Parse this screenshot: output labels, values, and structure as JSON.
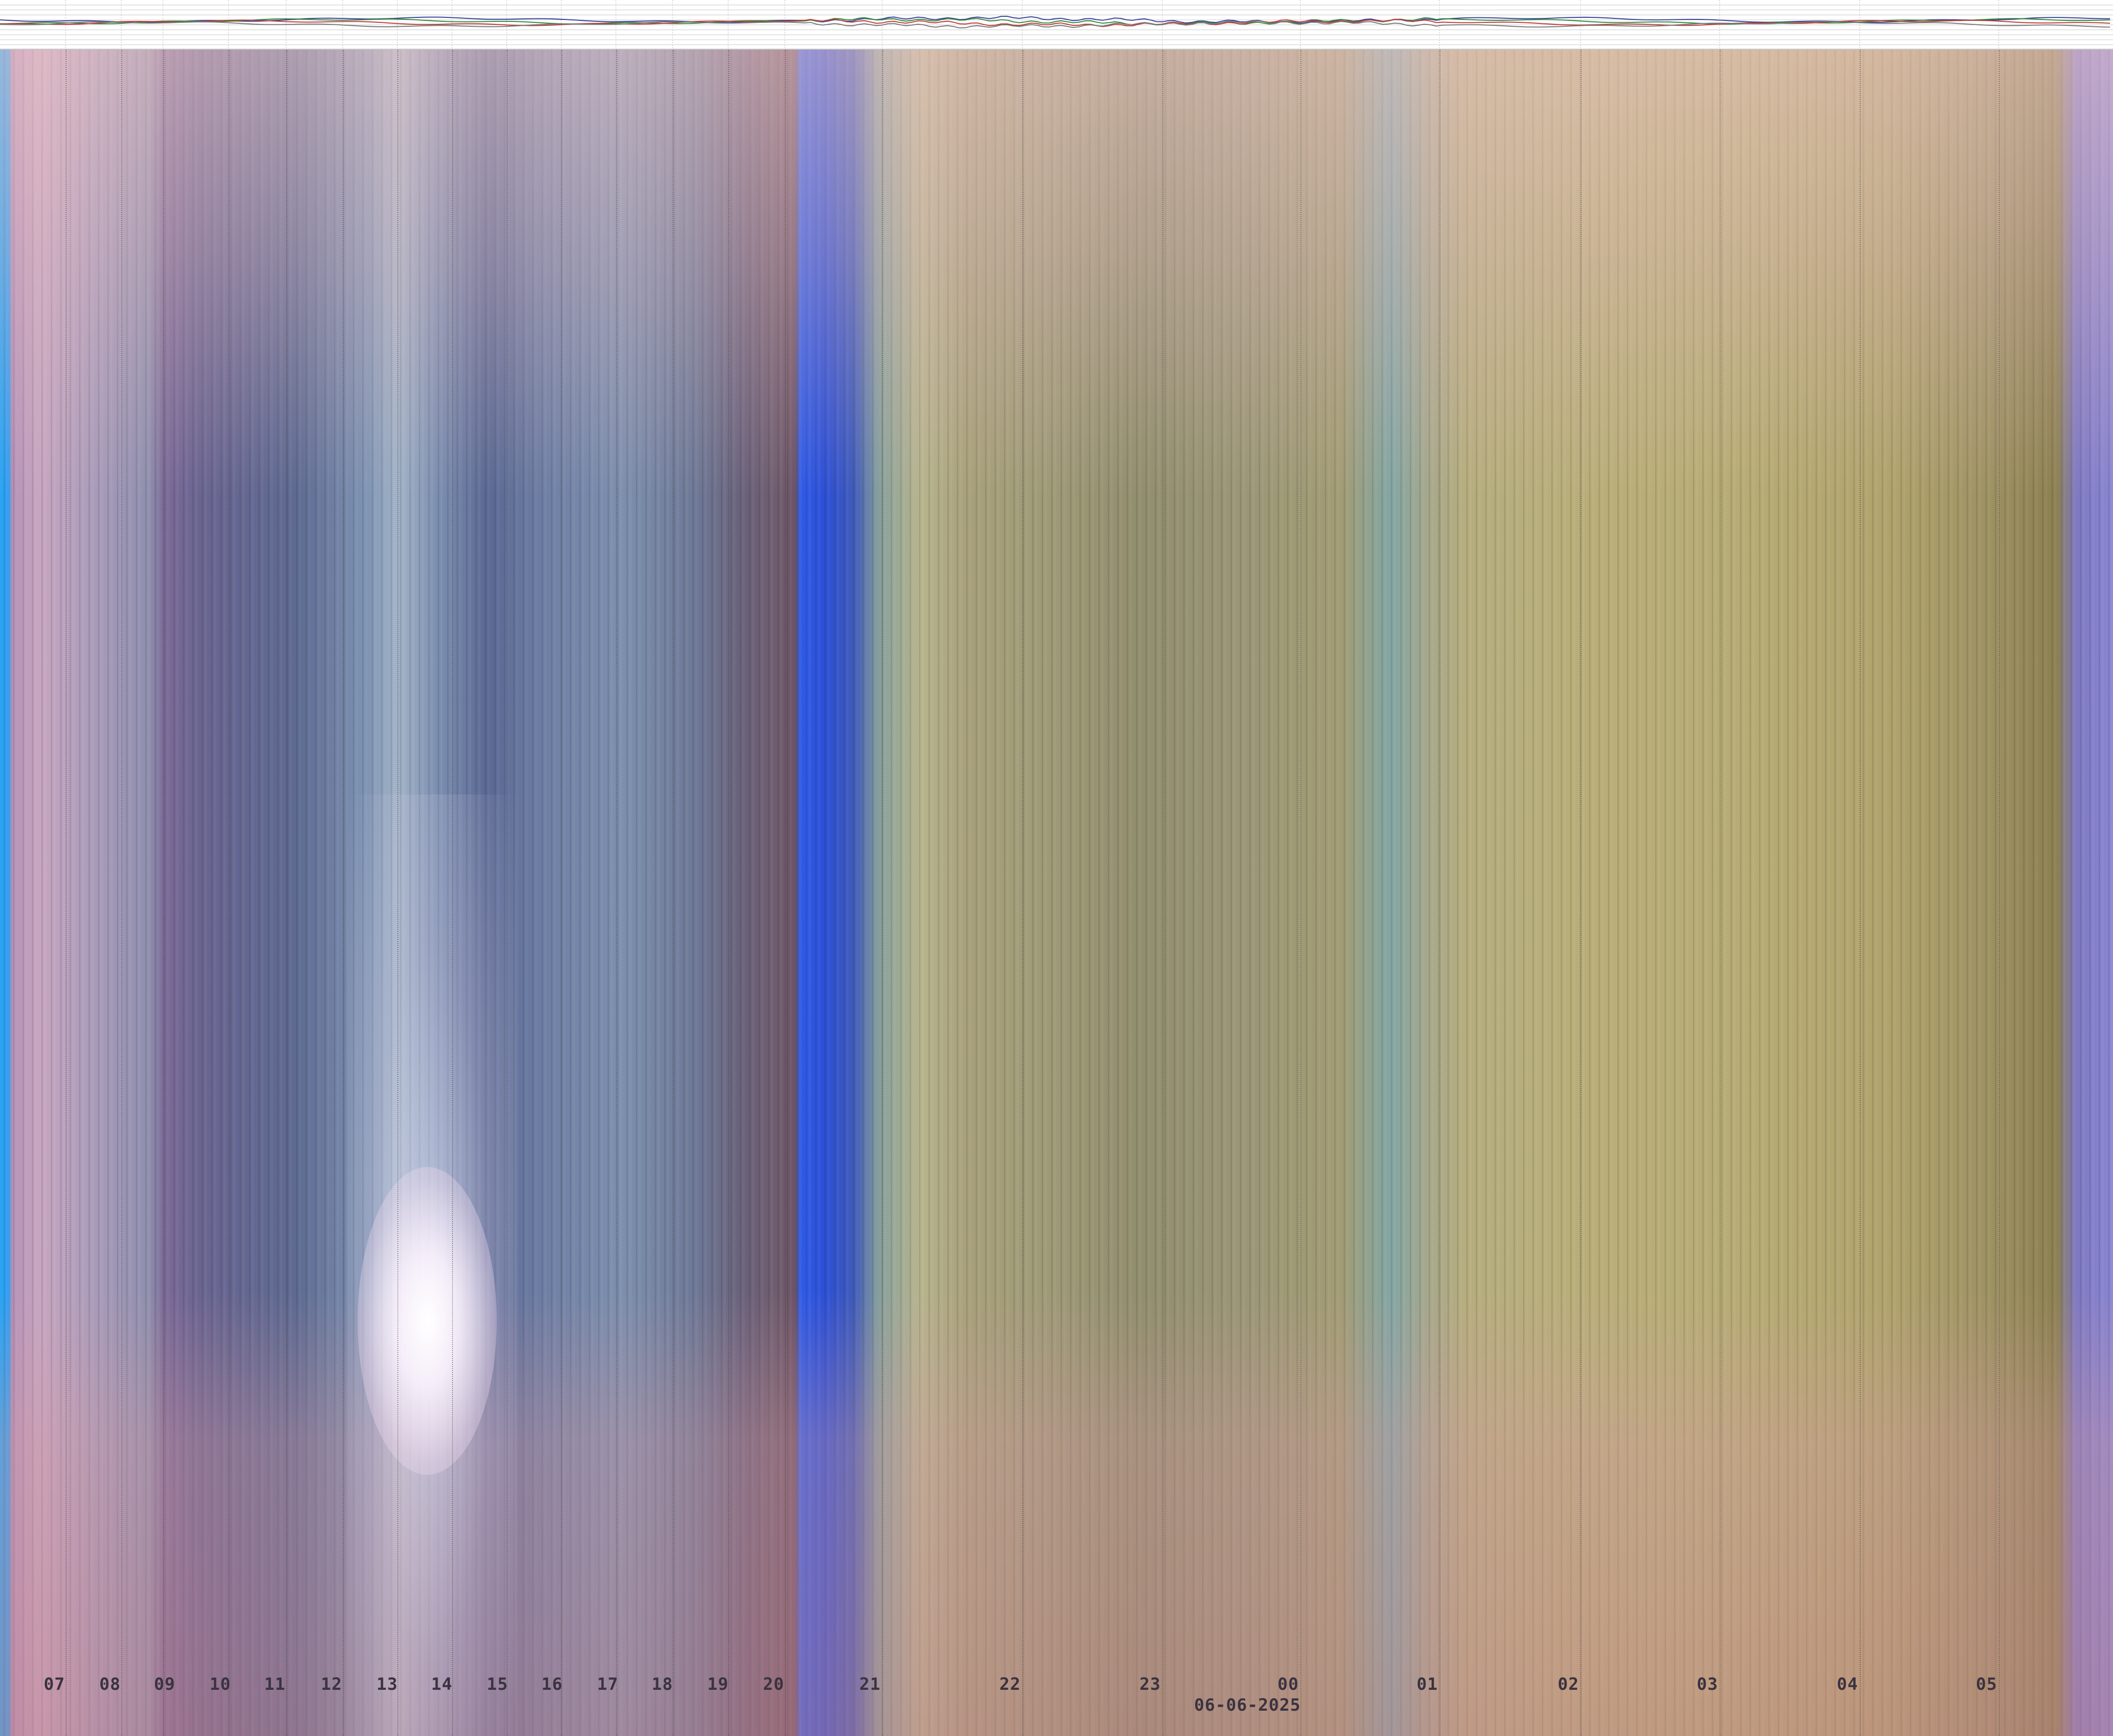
{
  "date_label": "06-06-2025",
  "hour_labels": [
    "07",
    "08",
    "09",
    "10",
    "11",
    "12",
    "13",
    "14",
    "15",
    "16",
    "17",
    "18",
    "19",
    "20",
    "21",
    "22",
    "23",
    "00",
    "01",
    "02",
    "03",
    "04",
    "05"
  ],
  "colors": {
    "sensor_series": [
      "#3a3f9c",
      "#2e8b3c",
      "#c23a3a",
      "#7a7a7a"
    ],
    "grid": "#c8c8c8"
  },
  "sensor_chart": {
    "series_count": 4,
    "gridlines_visible": true
  }
}
